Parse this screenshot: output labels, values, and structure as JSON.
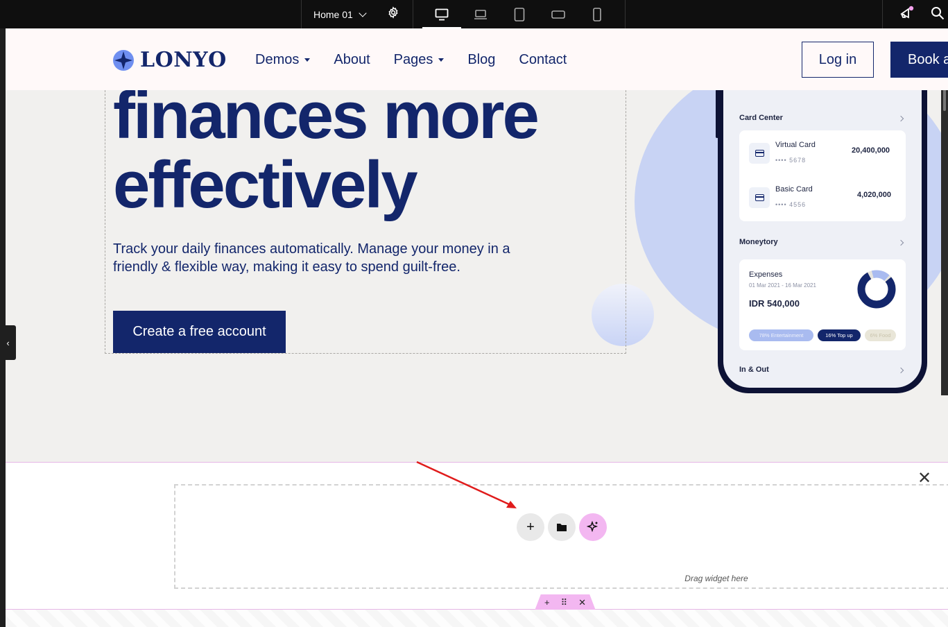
{
  "editor": {
    "page_name": "Home 01",
    "devices": [
      "desktop-icon",
      "laptop-icon",
      "tablet-icon",
      "tablet-landscape-icon",
      "mobile-icon"
    ]
  },
  "nav": {
    "logo": "LONYO",
    "links": [
      {
        "label": "Demos",
        "dropdown": true
      },
      {
        "label": "About",
        "dropdown": false
      },
      {
        "label": "Pages",
        "dropdown": true
      },
      {
        "label": "Blog",
        "dropdown": false
      },
      {
        "label": "Contact",
        "dropdown": false
      }
    ],
    "login": "Log in",
    "book": "Book a"
  },
  "hero": {
    "title_line1": "finances more",
    "title_line2": "effectively",
    "subtitle": "Track your daily finances automatically. Manage your money in a friendly & flexible way, making it easy to spend guilt-free.",
    "cta": "Create a free account"
  },
  "phone": {
    "card_center": "Card Center",
    "cards": [
      {
        "name": "Virtual Card",
        "masked": "•••• 5678",
        "value": "20,400,000"
      },
      {
        "name": "Basic Card",
        "masked": "•••• 4556",
        "value": "4,020,000"
      }
    ],
    "moneytory": "Moneytory",
    "expenses_title": "Expenses",
    "expenses_range": "01 Mar 2021 - 16 Mar 2021",
    "expenses_value": "IDR 540,000",
    "pills": [
      "78% Entertainment",
      "16% Top up",
      "6% Food"
    ],
    "in_out": "In & Out"
  },
  "dropzone": {
    "text": "Drag widget here"
  },
  "colors": {
    "brand": "#13266b",
    "ai_accent": "#f3b7f1"
  }
}
